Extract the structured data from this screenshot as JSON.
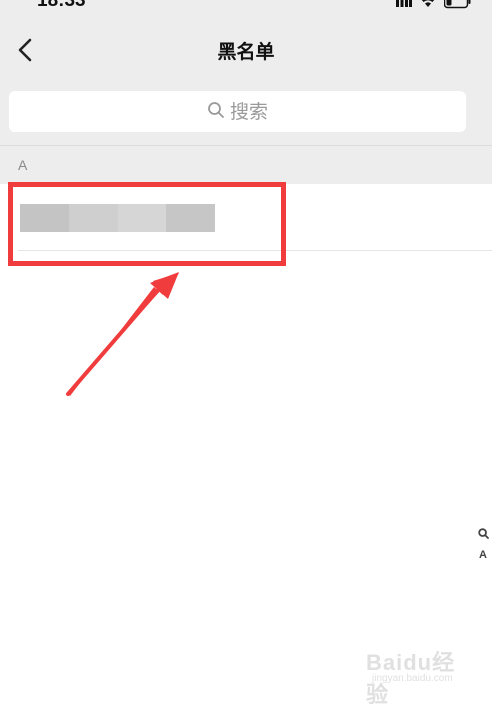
{
  "status_bar": {
    "time": "18:33",
    "icons": [
      "signal-icon",
      "wifi-icon",
      "battery-icon"
    ]
  },
  "nav": {
    "title": "黑名单",
    "back_icon": "chevron-left-icon"
  },
  "search": {
    "icon": "search-icon",
    "placeholder": "搜索"
  },
  "sections": [
    {
      "header": "A",
      "items": [
        {
          "name_visible": false
        }
      ]
    }
  ],
  "index_bar": {
    "search_icon": "search-icon",
    "letters": [
      "A"
    ]
  },
  "watermark": {
    "text": "Baidu经验",
    "sub": "jingyan.baidu.com"
  },
  "colors": {
    "background": "#ededed",
    "annotation_red": "#f03c3c",
    "placeholder": "#9a9a9a"
  }
}
